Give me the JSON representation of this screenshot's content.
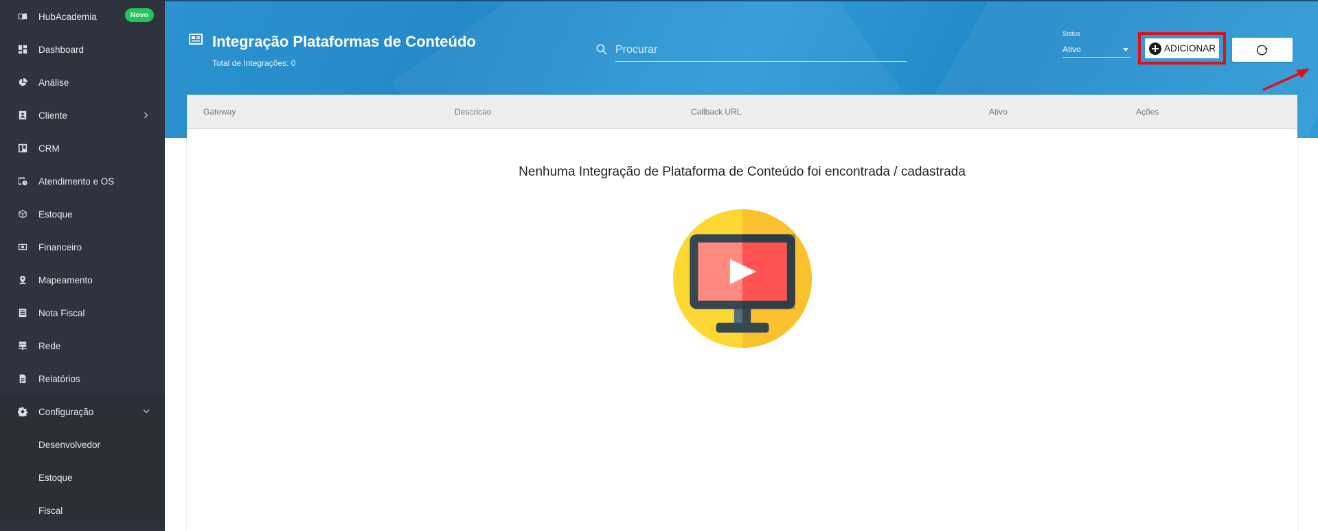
{
  "sidebar": {
    "items": [
      {
        "label": "HubAcademia",
        "icon": "book-open-icon",
        "badge": "Novo"
      },
      {
        "label": "Dashboard",
        "icon": "dashboard-icon"
      },
      {
        "label": "Análise",
        "icon": "pie-chart-icon"
      },
      {
        "label": "Cliente",
        "icon": "contact-card-icon"
      },
      {
        "label": "CRM",
        "icon": "kanban-icon"
      },
      {
        "label": "Atendimento e OS",
        "icon": "calendar-clock-icon"
      },
      {
        "label": "Estoque",
        "icon": "box-icon"
      },
      {
        "label": "Financeiro",
        "icon": "money-icon"
      },
      {
        "label": "Mapeamento",
        "icon": "map-pin-icon"
      },
      {
        "label": "Nota Fiscal",
        "icon": "receipt-icon"
      },
      {
        "label": "Rede",
        "icon": "network-icon"
      },
      {
        "label": "Relatórios",
        "icon": "document-icon"
      },
      {
        "label": "Configuração",
        "icon": "gear-icon"
      }
    ],
    "config_subitems": [
      {
        "label": "Desenvolvedor"
      },
      {
        "label": "Estoque"
      },
      {
        "label": "Fiscal"
      }
    ]
  },
  "header": {
    "title": "Integração Plataformas de Conteúdo",
    "subtitle": "Total de Integrações: 0",
    "search_placeholder": "Procurar",
    "status_label": "Status",
    "status_value": "Ativo",
    "add_label": "ADICIONAR"
  },
  "table": {
    "columns": [
      "Gateway",
      "Descricao",
      "Callback URL",
      "Ativo",
      "Ações"
    ],
    "empty_message": "Nenhuma Integração de Plataforma de Conteúdo foi encontrada / cadastrada"
  },
  "colors": {
    "sidebar_bg": "#2f333d",
    "header_blue": "#2a8fcd",
    "badge_green": "#22c55e",
    "highlight_red": "#e0101a"
  }
}
